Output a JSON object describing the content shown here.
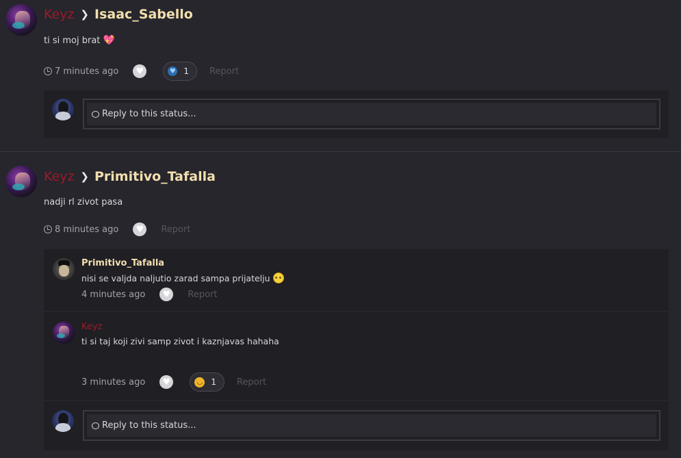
{
  "statuses": [
    {
      "author": "Keyz",
      "target": "Isaac_Sabello",
      "message": "ti si moj brat",
      "message_emoji": "heart-emoji",
      "time": "7 minutes ago",
      "reaction_count": "1",
      "reaction_icon": "heart-reaction-icon",
      "report_label": "Report",
      "reply_placeholder": "Reply to this status..."
    },
    {
      "author": "Keyz",
      "target": "Primitivo_Tafalla",
      "message": "nadji rl zivot pasa",
      "time": "8 minutes ago",
      "report_label": "Report",
      "comments": [
        {
          "author": "Primitivo_Tafalla",
          "text": "nisi se valjda naljutio zarad sampa prijatelju",
          "text_emoji": "rolling-eyes-emoji",
          "time": "4 minutes ago",
          "report_label": "Report"
        },
        {
          "author": "Keyz",
          "text": "ti si taj koji zivi samp zivot i kaznjavas hahaha",
          "time": "3 minutes ago",
          "reaction_count": "1",
          "reaction_icon": "laugh-reaction-icon",
          "report_label": "Report"
        }
      ],
      "reply_placeholder": "Reply to this status..."
    }
  ],
  "colors": {
    "background": "#26262c",
    "panel": "#1f1f24",
    "author_red": "#9b1b2a",
    "target_gold": "#f3dfae",
    "muted": "#a3a3aa"
  }
}
